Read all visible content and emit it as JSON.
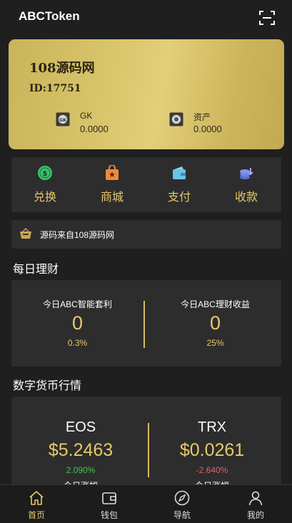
{
  "header": {
    "title": "ABCToken",
    "scan_icon": "scan-icon"
  },
  "card": {
    "name": "108源码网",
    "id_text": "ID:17751",
    "assets": [
      {
        "label": "GK",
        "value": "0.0000",
        "icon": "gk-coin-icon"
      },
      {
        "label": "资产",
        "value": "0.0000",
        "icon": "asset-coin-icon"
      }
    ]
  },
  "quick_actions": [
    {
      "label": "兑换",
      "icon": "exchange-coin-icon"
    },
    {
      "label": "商城",
      "icon": "shop-bag-icon"
    },
    {
      "label": "支付",
      "icon": "wallet-pay-icon"
    },
    {
      "label": "收款",
      "icon": "receive-coins-icon"
    }
  ],
  "notice": {
    "text": "源码来自108源码网",
    "icon": "notice-cart-icon"
  },
  "finance": {
    "title": "每日理财",
    "items": [
      {
        "name": "今日ABC智能套利",
        "value": "0",
        "rate": "0.3%"
      },
      {
        "name": "今日ABC理财收益",
        "value": "0",
        "rate": "25%"
      }
    ]
  },
  "market": {
    "title": "数字货币行情",
    "items": [
      {
        "symbol": "EOS",
        "price": "$5.2463",
        "change": "2.090%",
        "sub_label": "今日涨幅",
        "direction": "up"
      },
      {
        "symbol": "TRX",
        "price": "$0.0261",
        "change": "-2.640%",
        "sub_label": "今日涨幅",
        "direction": "down"
      }
    ]
  },
  "tabbar": {
    "items": [
      {
        "label": "首页",
        "icon": "home-icon",
        "active": true
      },
      {
        "label": "钱包",
        "icon": "wallet-icon",
        "active": false
      },
      {
        "label": "导航",
        "icon": "compass-icon",
        "active": false
      },
      {
        "label": "我的",
        "icon": "user-icon",
        "active": false
      }
    ]
  },
  "colors": {
    "accent": "#e6c96a",
    "background": "#1f1f1f",
    "panel": "#2d2d2d",
    "up": "#4cc24e",
    "down": "#e06363"
  }
}
